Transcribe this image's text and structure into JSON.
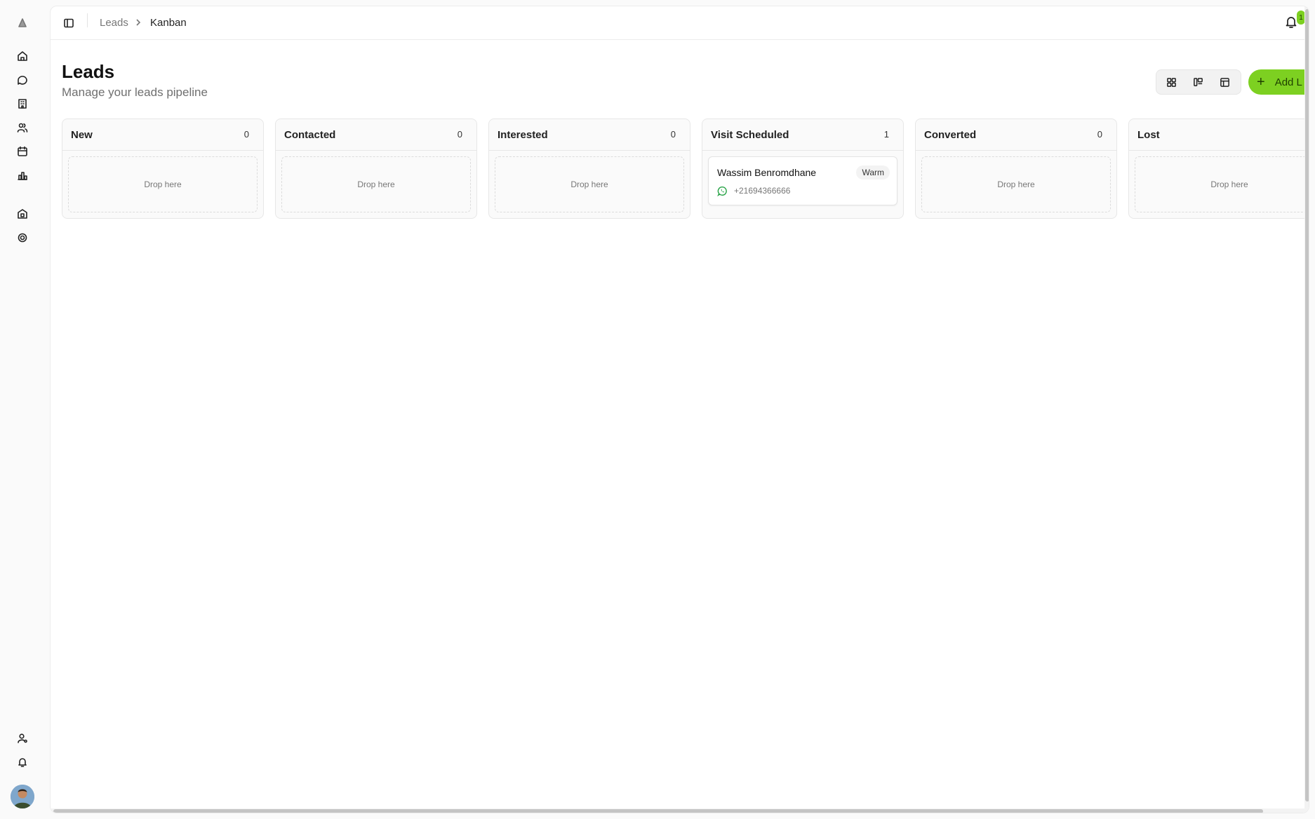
{
  "sidebar": {
    "items": [
      {
        "name": "logo-icon"
      },
      {
        "name": "home-icon"
      },
      {
        "name": "chat-icon"
      },
      {
        "name": "building-icon"
      },
      {
        "name": "users-icon"
      },
      {
        "name": "calendar-icon"
      },
      {
        "name": "analytics-icon"
      },
      {
        "name": "properties-icon"
      },
      {
        "name": "settings-icon"
      },
      {
        "name": "user-settings-icon"
      },
      {
        "name": "bell-icon"
      }
    ]
  },
  "breadcrumb": {
    "items": [
      "Leads",
      "Kanban"
    ]
  },
  "notifications": {
    "count": "1"
  },
  "header": {
    "title": "Leads",
    "subtitle": "Manage your leads pipeline",
    "add_button_label": "Add L"
  },
  "kanban": {
    "drop_label": "Drop here",
    "columns": [
      {
        "title": "New",
        "count": "0"
      },
      {
        "title": "Contacted",
        "count": "0"
      },
      {
        "title": "Interested",
        "count": "0"
      },
      {
        "title": "Visit Scheduled",
        "count": "1"
      },
      {
        "title": "Converted",
        "count": "0"
      },
      {
        "title": "Lost",
        "count": ""
      }
    ],
    "card": {
      "name": "Wassim Benromdhane",
      "temperature": "Warm",
      "phone": "+21694366666"
    }
  },
  "colors": {
    "accent": "#7dd021",
    "border": "#e7e7e7",
    "whatsapp": "#25a244"
  }
}
